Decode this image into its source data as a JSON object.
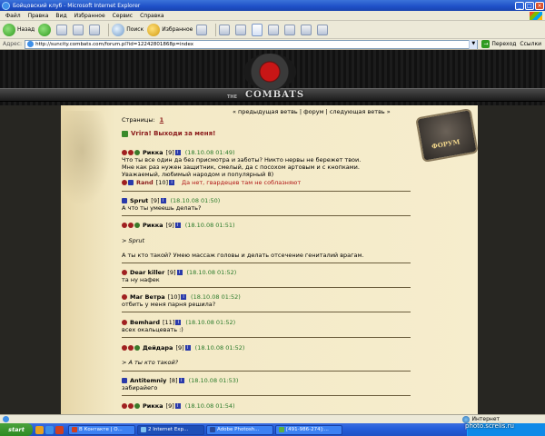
{
  "window": {
    "title": "Бойцовский клуб - Microsoft Internet Explorer",
    "minimize": "_",
    "maximize": "□",
    "close": "×"
  },
  "menu": [
    "Файл",
    "Правка",
    "Вид",
    "Избранное",
    "Сервис",
    "Справка"
  ],
  "toolbar": {
    "back": "Назад",
    "search": "Поиск",
    "favorites": "Избранное"
  },
  "address": {
    "label": "Адрес:",
    "url": "http://suncity.combats.com/forum.pl?id=12242801868p=index",
    "go": "Переход",
    "links": "Ссылки"
  },
  "site": {
    "logo_prefix": "THE",
    "logo": "COMBATS",
    "forum_badge": "ФОРУМ"
  },
  "nav": {
    "prev": "« предыдущая ветвь",
    "sep1": " | ",
    "forum": "форум",
    "sep2": " | ",
    "next": "следующая ветвь »"
  },
  "pages": {
    "label": "Страницы:",
    "current": "1"
  },
  "thread_title": "Vrira! Выходи за меня!",
  "posts": [
    {
      "author": "Рикка",
      "level": "[9]",
      "time": "(18.10.08 01:49)",
      "lines": [
        "Что ты все один да без присмотра и заботы? Никто нервы не бережет твои.",
        "Мне как раз нужен защитник, смелый, да с посохом артовым и с кнопками.",
        "Уважаемый, любимый народом и популярный 8)"
      ],
      "reply_author": "Rand",
      "reply_level": "[10]",
      "reply_text": "Да нет, гвардецев там не соблазняют"
    },
    {
      "author": "Sprut",
      "level": "[9]",
      "time": "(18.10.08 01:50)",
      "lines": [
        "А что ты умеешь делать?"
      ]
    },
    {
      "author": "Рикка",
      "level": "[9]",
      "time": "(18.10.08 01:51)",
      "quote": "> Sprut",
      "lines": [
        "А ты кто такой? Умею массаж головы и делать отсечение гениталий врагам."
      ]
    },
    {
      "author": "Dear killer",
      "level": "[9]",
      "time": "(18.10.08 01:52)",
      "lines": [
        "та ну нафек"
      ]
    },
    {
      "author": "Маг Ветра",
      "level": "[10]",
      "time": "(18.10.08 01:52)",
      "lines": [
        "отбить у меня парня решила?"
      ]
    },
    {
      "author": "Bemhard",
      "level": "[11]",
      "time": "(18.10.08 01:52)",
      "lines": [
        "всех окальцевать :)"
      ]
    },
    {
      "author": "Дейдара",
      "level": "[9]",
      "time": "(18.10.08 01:52)",
      "quote": "> А ты кто такой?",
      "lines": []
    },
    {
      "author": "Antitemniy",
      "level": "[8]",
      "time": "(18.10.08 01:53)",
      "lines": [
        "забирайего"
      ]
    },
    {
      "author": "Рикка",
      "level": "[9]",
      "time": "(18.10.08 01:54)",
      "lines": []
    }
  ],
  "status": {
    "zone": "Интернет"
  },
  "taskbar": {
    "start": "start",
    "tasks": [
      "В Контакте | О...",
      "2 Internet Exp...",
      "Adobe Photosh...",
      "[491-986-274]:..."
    ]
  },
  "watermark": "photo.screlis.ru"
}
